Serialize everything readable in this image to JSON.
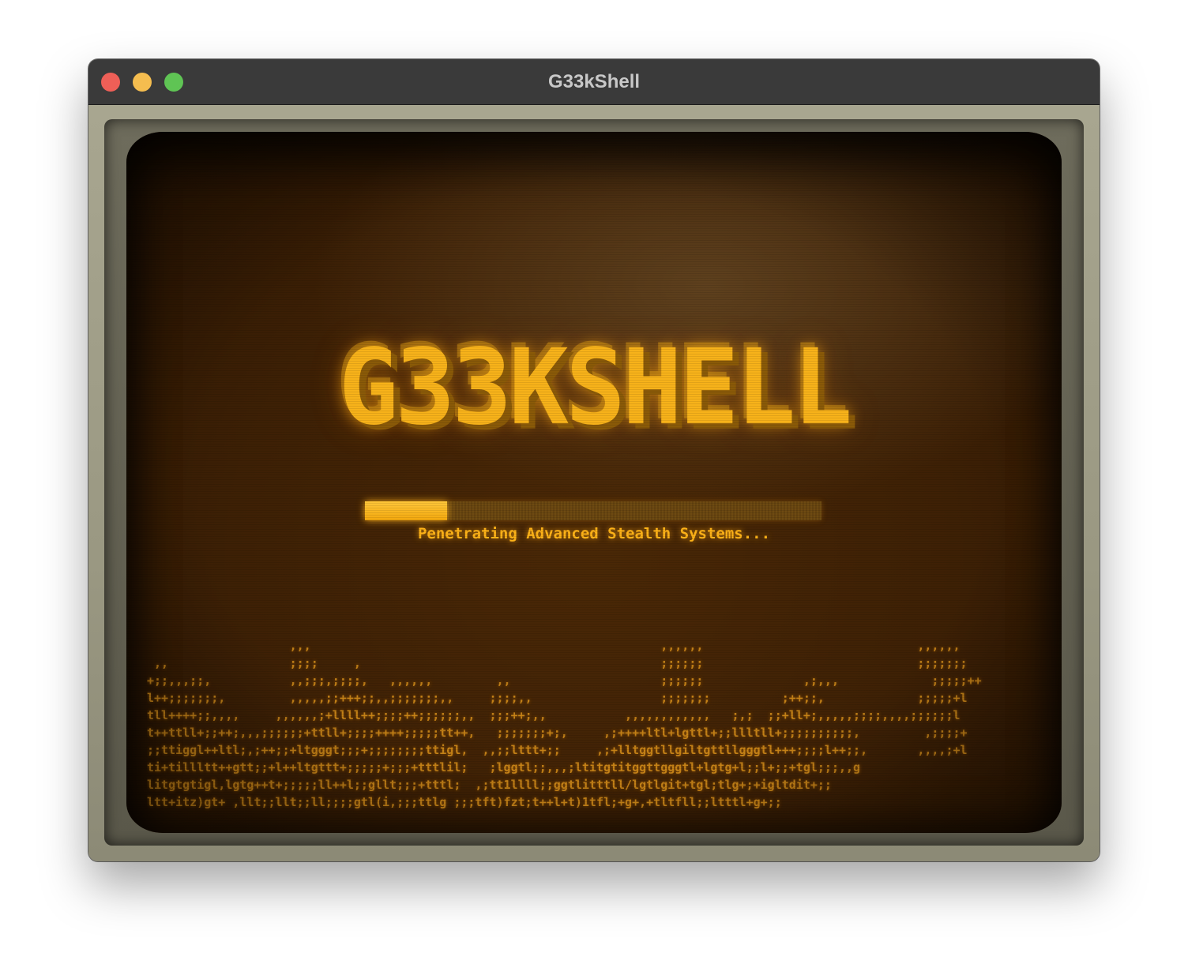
{
  "window": {
    "title": "G33kShell"
  },
  "screen": {
    "logo_text": "G33KSHELL",
    "progress": 0.18,
    "status": "Penetrating Advanced Stealth Systems...",
    "noise_text": "                    ,,,                                                 ,,,,,,                              ,,,,,,\n ,,                 ;;;;     ,                                          ;;;;;;                              ;;;;;;;\n+;;,,,;;,           ,,;;;,;;;;,   ,,,,,,         ,,                     ;;;;;;              ,;,,,             ;;;;;++\nl++;;;;;;;,         ,,,,,;;+++;;,,;;;;;;;,,     ;;;;,,                  ;;;;;;;          ;++;;,             ;;;;;+l\ntll++++;;,,,,     ,,,,,,;+llll++;;;;++;;;;;;,,  ;;;++;,,           ,,,,,,,,,,,,   ;,;  ;;+ll+;,,,,,;;;;,,,,;;;;;;l\nt++ttll+;;++;,,,;;;;;;+ttll+;;;;++++;;;;;tt++,   ;;;;;;;+;,     ,;++++ltl+lgttl+;;llltll+;;;;;;;;;;,         ,;;;;+\n;;ttiggl++ltl;,;++;;+ltgggt;;;+;;;;;;;;ttigl,  ,,;;lttt+;;     ,;+lltggtllgiltgttllgggtl+++;;;;l++;;,       ,,,,;+l\nti+tillltt++gtt;;+l++ltgttt+;;;;;+;;;+tttlil;   ;lggtl;;,,,;ltitgtitggttgggtl+lgtg+l;;l+;;+tgl;;;,,g\nlitgtgtigl,lgtg++t+;;;;;ll++l;;gllt;;;+tttl;  ,;tt1llll;;ggtlitttll/lgtlgit+tgl;tlg+;+igltdit+;;\nltt+itz)gt+ ,llt;;llt;;ll;;;;gtl(i,;;;ttlg ;;;tft)fzt;t++l+t)1tfl;+g+,+tltfll;;ltttl+g+;;"
  }
}
